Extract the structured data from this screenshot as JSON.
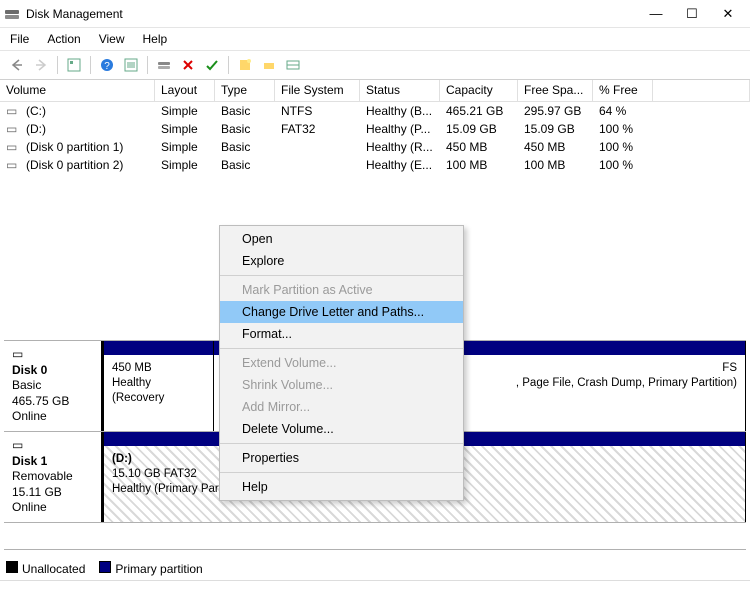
{
  "window": {
    "title": "Disk Management"
  },
  "menu": {
    "file": "File",
    "action": "Action",
    "view": "View",
    "help": "Help"
  },
  "headers": {
    "volume": "Volume",
    "layout": "Layout",
    "type": "Type",
    "filesystem": "File System",
    "status": "Status",
    "capacity": "Capacity",
    "freespace": "Free Spa...",
    "pctfree": "% Free"
  },
  "volumes": [
    {
      "name": "(C:)",
      "layout": "Simple",
      "type": "Basic",
      "fs": "NTFS",
      "status": "Healthy (B...",
      "capacity": "465.21 GB",
      "free": "295.97 GB",
      "pct": "64 %"
    },
    {
      "name": "(D:)",
      "layout": "Simple",
      "type": "Basic",
      "fs": "FAT32",
      "status": "Healthy (P...",
      "capacity": "15.09 GB",
      "free": "15.09 GB",
      "pct": "100 %"
    },
    {
      "name": "(Disk 0 partition 1)",
      "layout": "Simple",
      "type": "Basic",
      "fs": "",
      "status": "Healthy (R...",
      "capacity": "450 MB",
      "free": "450 MB",
      "pct": "100 %"
    },
    {
      "name": "(Disk 0 partition 2)",
      "layout": "Simple",
      "type": "Basic",
      "fs": "",
      "status": "Healthy (E...",
      "capacity": "100 MB",
      "free": "100 MB",
      "pct": "100 %"
    }
  ],
  "disks": [
    {
      "label": "Disk 0",
      "type": "Basic",
      "size": "465.75 GB",
      "status": "Online",
      "parts": [
        {
          "title": "",
          "line1": "450 MB",
          "line2": "Healthy (Recovery"
        },
        {
          "title": "",
          "line1": "FS",
          "line2": ", Page File, Crash Dump, Primary Partition)"
        }
      ]
    },
    {
      "label": "Disk 1",
      "type": "Removable",
      "size": "15.11 GB",
      "status": "Online",
      "parts": [
        {
          "title": "(D:)",
          "line1": "15.10 GB FAT32",
          "line2": "Healthy (Primary Partition)"
        }
      ]
    }
  ],
  "legend": {
    "unallocated": "Unallocated",
    "primary": "Primary partition"
  },
  "context_menu": [
    {
      "label": "Open",
      "enabled": true
    },
    {
      "label": "Explore",
      "enabled": true
    },
    {
      "sep": true
    },
    {
      "label": "Mark Partition as Active",
      "enabled": false
    },
    {
      "label": "Change Drive Letter and Paths...",
      "enabled": true,
      "selected": true
    },
    {
      "label": "Format...",
      "enabled": true
    },
    {
      "sep": true
    },
    {
      "label": "Extend Volume...",
      "enabled": false
    },
    {
      "label": "Shrink Volume...",
      "enabled": false
    },
    {
      "label": "Add Mirror...",
      "enabled": false
    },
    {
      "label": "Delete Volume...",
      "enabled": true
    },
    {
      "sep": true
    },
    {
      "label": "Properties",
      "enabled": true
    },
    {
      "sep": true
    },
    {
      "label": "Help",
      "enabled": true
    }
  ]
}
